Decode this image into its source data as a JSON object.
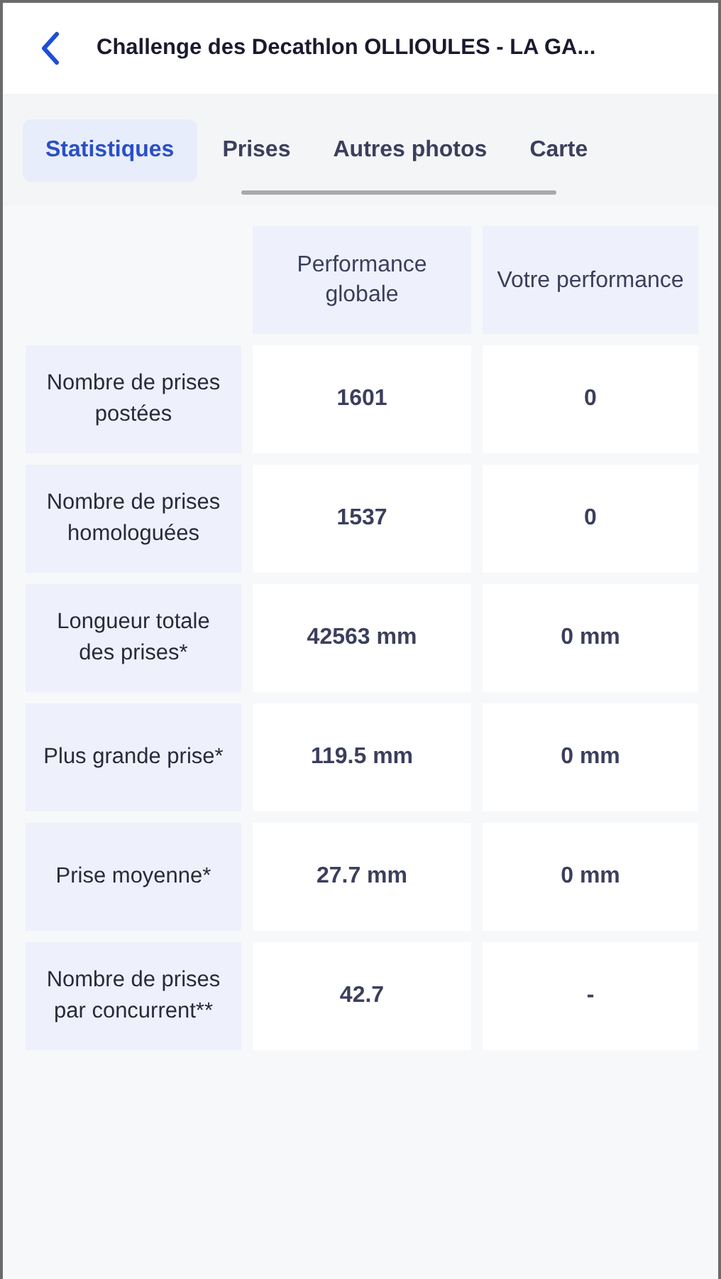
{
  "header": {
    "title": "Challenge des Decathlon OLLIOULES - LA GA..."
  },
  "tabs": [
    {
      "label": "Statistiques",
      "selected": true
    },
    {
      "label": "Prises",
      "selected": false
    },
    {
      "label": "Autres photos",
      "selected": false
    },
    {
      "label": "Carte",
      "selected": false
    }
  ],
  "table": {
    "columns": [
      "Performance globale",
      "Votre performance"
    ],
    "rows": [
      {
        "label": "Nombre de prises postées",
        "global": "1601",
        "yours": "0"
      },
      {
        "label": "Nombre de prises homologuées",
        "global": "1537",
        "yours": "0"
      },
      {
        "label": "Longueur totale des prises*",
        "global": "42563 mm",
        "yours": "0 mm"
      },
      {
        "label": "Plus grande prise*",
        "global": "119.5 mm",
        "yours": "0 mm"
      },
      {
        "label": "Prise moyenne*",
        "global": "27.7 mm",
        "yours": "0 mm"
      },
      {
        "label": "Nombre de prises par concurrent**",
        "global": "42.7",
        "yours": "-"
      }
    ]
  }
}
